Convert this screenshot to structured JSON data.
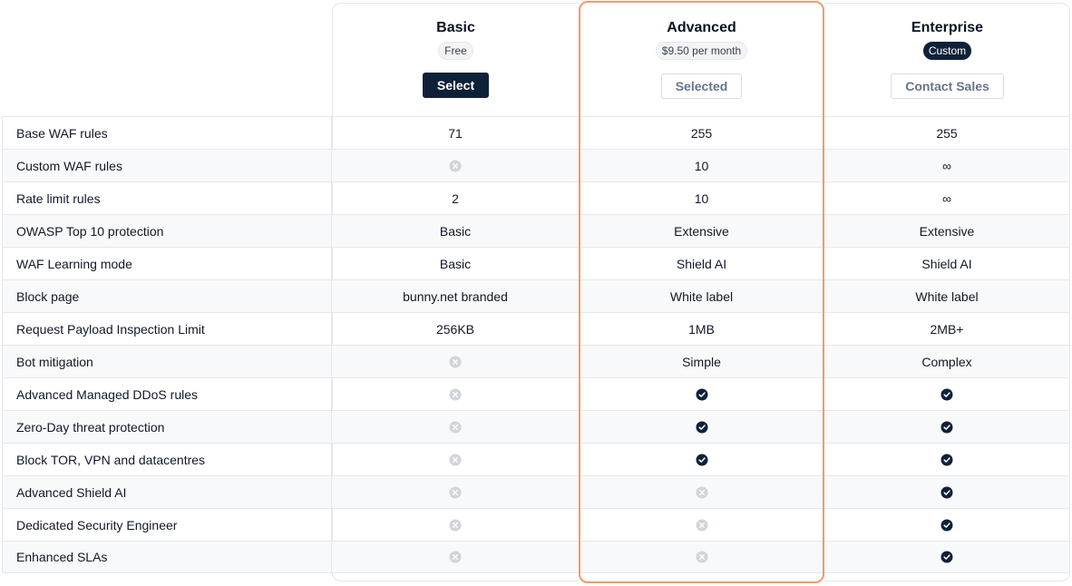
{
  "plans": [
    {
      "name": "Basic",
      "price": "Free",
      "price_style": "light",
      "button": "Select",
      "button_style": "primary"
    },
    {
      "name": "Advanced",
      "price": "$9.50 per month",
      "price_style": "light",
      "button": "Selected",
      "button_style": "ghost"
    },
    {
      "name": "Enterprise",
      "price": "Custom",
      "price_style": "dark",
      "button": "Contact Sales",
      "button_style": "ghost"
    }
  ],
  "features": [
    {
      "label": "Base WAF rules",
      "values": [
        "71",
        "255",
        "255"
      ]
    },
    {
      "label": "Custom WAF rules",
      "values": [
        {
          "icon": "x-circle-icon"
        },
        "10",
        "∞"
      ]
    },
    {
      "label": "Rate limit rules",
      "values": [
        "2",
        "10",
        "∞"
      ]
    },
    {
      "label": "OWASP Top 10 protection",
      "values": [
        "Basic",
        "Extensive",
        "Extensive"
      ]
    },
    {
      "label": "WAF Learning mode",
      "values": [
        "Basic",
        "Shield AI",
        "Shield AI"
      ]
    },
    {
      "label": "Block page",
      "values": [
        "bunny.net branded",
        "White label",
        "White label"
      ]
    },
    {
      "label": "Request Payload Inspection Limit",
      "values": [
        "256KB",
        "1MB",
        "2MB+"
      ]
    },
    {
      "label": "Bot mitigation",
      "values": [
        {
          "icon": "x-circle-icon"
        },
        "Simple",
        "Complex"
      ]
    },
    {
      "label": "Advanced Managed DDoS rules",
      "values": [
        {
          "icon": "x-circle-icon"
        },
        {
          "icon": "check-circle-icon"
        },
        {
          "icon": "check-circle-icon"
        }
      ]
    },
    {
      "label": "Zero-Day threat protection",
      "values": [
        {
          "icon": "x-circle-icon"
        },
        {
          "icon": "check-circle-icon"
        },
        {
          "icon": "check-circle-icon"
        }
      ]
    },
    {
      "label": "Block TOR, VPN and datacentres",
      "values": [
        {
          "icon": "x-circle-icon"
        },
        {
          "icon": "check-circle-icon"
        },
        {
          "icon": "check-circle-icon"
        }
      ]
    },
    {
      "label": "Advanced Shield AI",
      "values": [
        {
          "icon": "x-circle-icon"
        },
        {
          "icon": "x-circle-icon"
        },
        {
          "icon": "check-circle-icon"
        }
      ]
    },
    {
      "label": "Dedicated Security Engineer",
      "values": [
        {
          "icon": "x-circle-icon"
        },
        {
          "icon": "x-circle-icon"
        },
        {
          "icon": "check-circle-icon"
        }
      ]
    },
    {
      "label": "Enhanced SLAs",
      "values": [
        {
          "icon": "x-circle-icon"
        },
        {
          "icon": "x-circle-icon"
        },
        {
          "icon": "check-circle-icon"
        }
      ]
    }
  ],
  "colors": {
    "primary": "#0f2139",
    "highlight_border": "#f19a6b",
    "x_icon": "#d1d5db",
    "check_icon": "#0f2139"
  }
}
